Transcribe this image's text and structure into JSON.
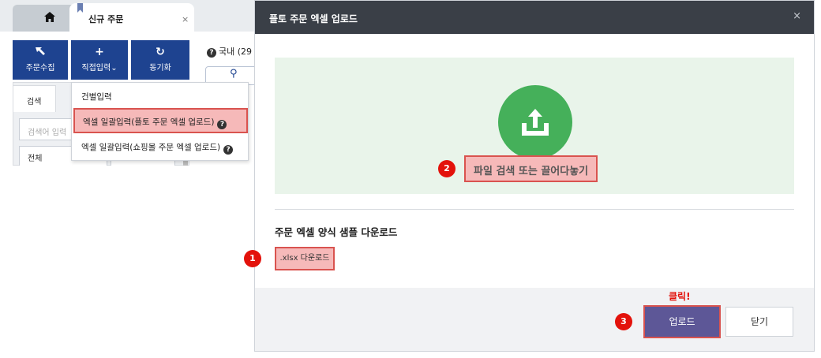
{
  "tabs": {
    "order_tab_label": "신규 주문",
    "close_glyph": "×"
  },
  "toolbar": {
    "collect_label": "주문수집",
    "direct_label": "직접입력⌄",
    "sync_label": "동기화",
    "domestic_label": "국내 (29"
  },
  "search_panel": {
    "tab_label": "검색",
    "search_placeholder": "검색어 입력",
    "select_value": "전체"
  },
  "dropdown_menu": {
    "items": [
      {
        "label": "건별입력"
      },
      {
        "label": "엑셀 일괄입력(플토 주문 엑셀 업로드)"
      },
      {
        "label": "엑셀 일괄입력(쇼핑몰 주문 엑셀 업로드)"
      }
    ],
    "help_glyph": "?"
  },
  "modal": {
    "title": "플토 주문 엑셀 업로드",
    "close_glyph": "×",
    "dropzone_label": "파일 검색 또는 끌어다놓기",
    "sample_title": "주문 엑셀 양식 샘플 다운로드",
    "xlsx_button": ".xlsx 다운로드",
    "click_hint": "클릭!",
    "upload_button": "업로드",
    "close_button": "닫기"
  },
  "annotations": {
    "step1": "1",
    "step2": "2",
    "step3": "3"
  },
  "colors": {
    "header_dark": "#3a3f47",
    "toolbar_blue": "#1e4390",
    "dropzone_green": "#45b05a",
    "dropzone_bg": "#e9f4ea",
    "highlight_red": "#d9534f",
    "highlight_fill": "#f6b9b9",
    "step_badge": "#e3120b",
    "upload_purple": "#5d5797"
  }
}
